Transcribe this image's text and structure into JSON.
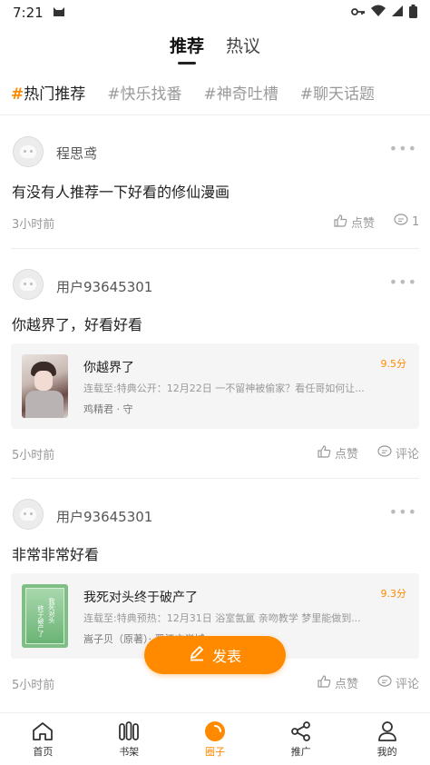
{
  "status_bar": {
    "time": "7:21"
  },
  "top_tabs": [
    {
      "label": "推荐",
      "active": true
    },
    {
      "label": "热议",
      "active": false
    }
  ],
  "topic_tabs": [
    {
      "hash": "#",
      "label": "热门推荐",
      "active": true
    },
    {
      "hash": "#",
      "label": "快乐找番",
      "active": false
    },
    {
      "hash": "#",
      "label": "神奇吐槽",
      "active": false
    },
    {
      "hash": "#",
      "label": "聊天话题",
      "active": false
    }
  ],
  "posts": [
    {
      "username": "程思鸢",
      "text": "有没有人推荐一下好看的修仙漫画",
      "time": "3小时前",
      "like_label": "点赞",
      "comment_label": "1"
    },
    {
      "username": "用户93645301",
      "text": "你越界了，好看好看",
      "time": "5小时前",
      "like_label": "点赞",
      "comment_label": "评论",
      "book": {
        "title": "你越界了",
        "score": "9.5分",
        "desc": "连载至:特典公开：12月22日 一不留神被偷家？看任哥如何让...",
        "author": "鸡精君 · 守"
      }
    },
    {
      "username": "用户93645301",
      "text": "非常非常好看",
      "time": "5小时前",
      "like_label": "点赞",
      "comment_label": "评论",
      "book": {
        "title": "我死对头终于破产了",
        "score": "9.3分",
        "desc": "连载至:特典预热：12月31日 浴室氤氲 亲吻教学 梦里能做到...",
        "author": "嵩子贝（原著）· 晋江文学城",
        "cover_text_1": "我死对头",
        "cover_text_2": "终于破产了"
      }
    }
  ],
  "fab": {
    "label": "发表"
  },
  "bottom_nav": [
    {
      "label": "首页",
      "icon": "home-icon",
      "active": false
    },
    {
      "label": "书架",
      "icon": "bookshelf-icon",
      "active": false
    },
    {
      "label": "圈子",
      "icon": "circle-icon",
      "active": true
    },
    {
      "label": "推广",
      "icon": "share-icon",
      "active": false
    },
    {
      "label": "我的",
      "icon": "user-icon",
      "active": false
    }
  ],
  "colors": {
    "accent": "#ff8a00",
    "muted": "#999999",
    "card": "#f5f5f5"
  }
}
